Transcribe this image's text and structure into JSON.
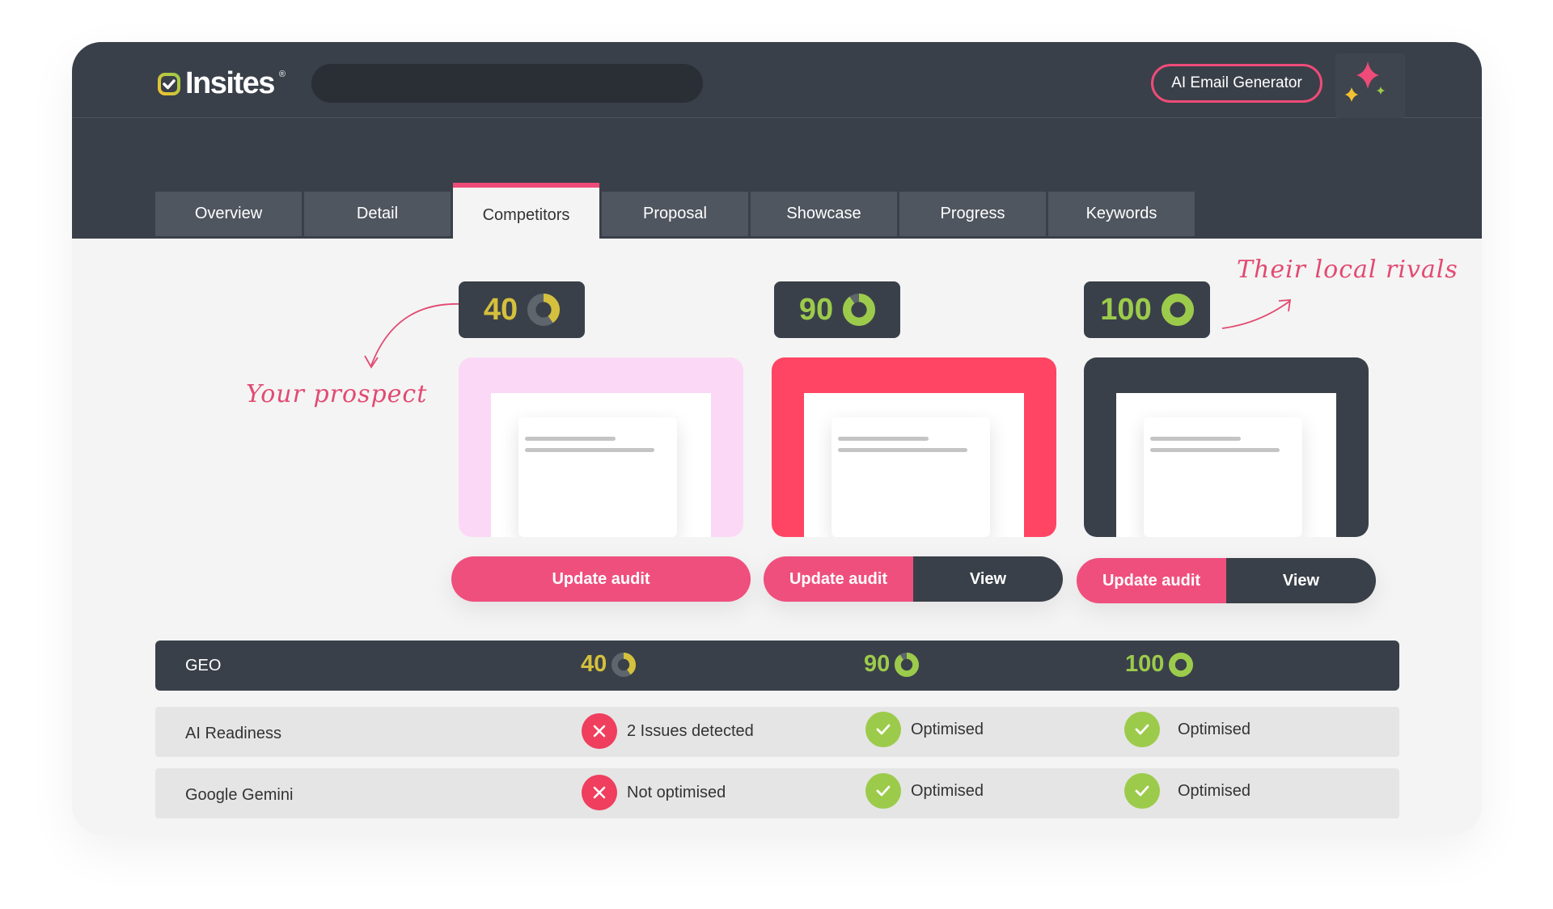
{
  "app": {
    "logo_text": "Insites",
    "logo_mark": "®",
    "ai_button_label": "AI Email Generator",
    "sparkle_icon": "sparkle-icon"
  },
  "tabs": [
    {
      "label": "Overview",
      "active": false
    },
    {
      "label": "Detail",
      "active": false
    },
    {
      "label": "Competitors",
      "active": true
    },
    {
      "label": "Proposal",
      "active": false
    },
    {
      "label": "Showcase",
      "active": false
    },
    {
      "label": "Progress",
      "active": false
    },
    {
      "label": "Keywords",
      "active": false
    }
  ],
  "annotations": {
    "prospect": "Your prospect",
    "rivals": "Their local rivals"
  },
  "competitors": [
    {
      "score": "40",
      "score_pct": 40,
      "score_color": "#d4c03c",
      "card_color": "#fbd9f6",
      "update_label": "Update audit",
      "view_label": null
    },
    {
      "score": "90",
      "score_pct": 90,
      "score_color": "#9ccb4b",
      "card_color": "#ff4563",
      "update_label": "Update audit",
      "view_label": "View"
    },
    {
      "score": "100",
      "score_pct": 100,
      "score_color": "#9ccb4b",
      "card_color": "#3a4049",
      "update_label": "Update audit",
      "view_label": "View"
    }
  ],
  "geo": {
    "label": "GEO",
    "scores": [
      "40",
      "90",
      "100"
    ]
  },
  "rows": [
    {
      "label": "AI Readiness",
      "statuses": [
        {
          "text": "2 Issues detected",
          "state": "bad",
          "icon": "x-icon"
        },
        {
          "text": "Optimised",
          "state": "good",
          "icon": "check-icon"
        },
        {
          "text": "Optimised",
          "state": "good",
          "icon": "check-icon"
        }
      ]
    },
    {
      "label": "Google Gemini",
      "statuses": [
        {
          "text": "Not optimised",
          "state": "bad",
          "icon": "x-icon"
        },
        {
          "text": "Optimised",
          "state": "good",
          "icon": "check-icon"
        },
        {
          "text": "Optimised",
          "state": "good",
          "icon": "check-icon"
        }
      ]
    }
  ],
  "colors": {
    "accent_pink": "#ef4f7d",
    "dark": "#3a4049",
    "green": "#9ccb4b",
    "yellow": "#d4c03c",
    "red": "#ef3e5e"
  }
}
